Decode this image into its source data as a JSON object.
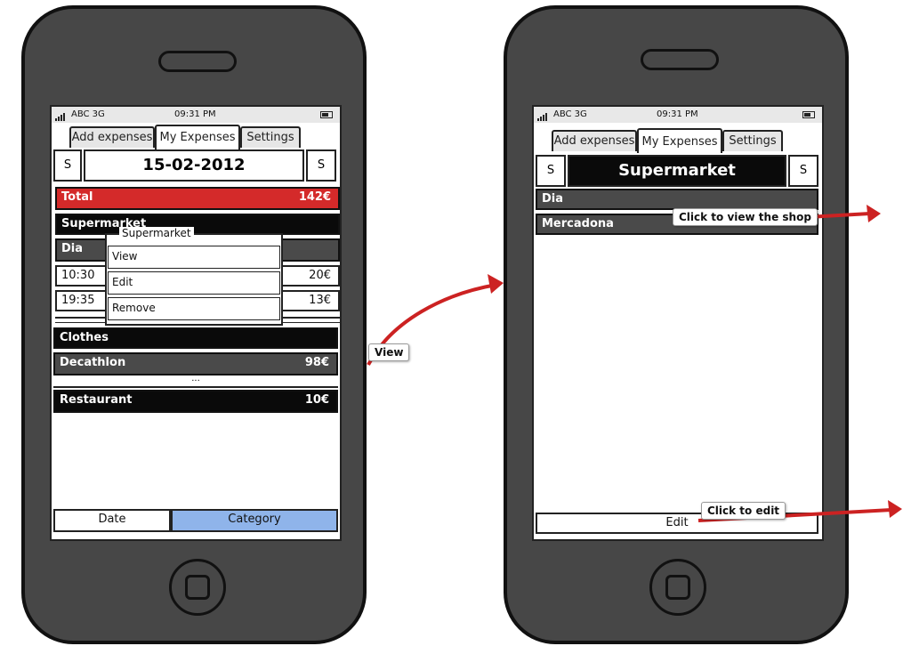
{
  "colors": {
    "phone_body": "#474747",
    "total_red": "#d42a2a",
    "dark_row": "#4a4a4a",
    "black_row": "#0a0a0a",
    "category_blue": "#8fb4ea",
    "arrow_red": "#cc2222"
  },
  "status_bar": {
    "carrier": "ABC 3G",
    "time": "09:31 PM"
  },
  "tabs": [
    "Add expenses",
    "My Expenses",
    "Settings"
  ],
  "screen1": {
    "prev_btn": "S",
    "next_btn": "S",
    "date": "15-02-2012",
    "total": {
      "label": "Total",
      "amount": "142€"
    },
    "supermarket": {
      "label": "Supermarket"
    },
    "dia": {
      "label": "Dia"
    },
    "entries": [
      {
        "time": "10:30",
        "amount": "20€"
      },
      {
        "time": "19:35",
        "amount": "13€"
      }
    ],
    "popup": {
      "title": "Supermarket",
      "items": [
        "View",
        "Edit",
        "Remove"
      ]
    },
    "clothes": {
      "label": "Clothes"
    },
    "decathlon": {
      "label": "Decathlon",
      "amount": "98€"
    },
    "ellipsis": "...",
    "restaurant": {
      "label": "Restaurant",
      "amount": "10€"
    },
    "sort": {
      "date": "Date",
      "category": "Category"
    }
  },
  "screen2": {
    "prev_btn": "S",
    "next_btn": "S",
    "title": "Supermarket",
    "dia": "Dia",
    "mercadona": "Mercadona",
    "edit": "Edit"
  },
  "callouts": {
    "view": "View",
    "view_shop": "Click to view the shop",
    "edit": "Click to edit"
  }
}
